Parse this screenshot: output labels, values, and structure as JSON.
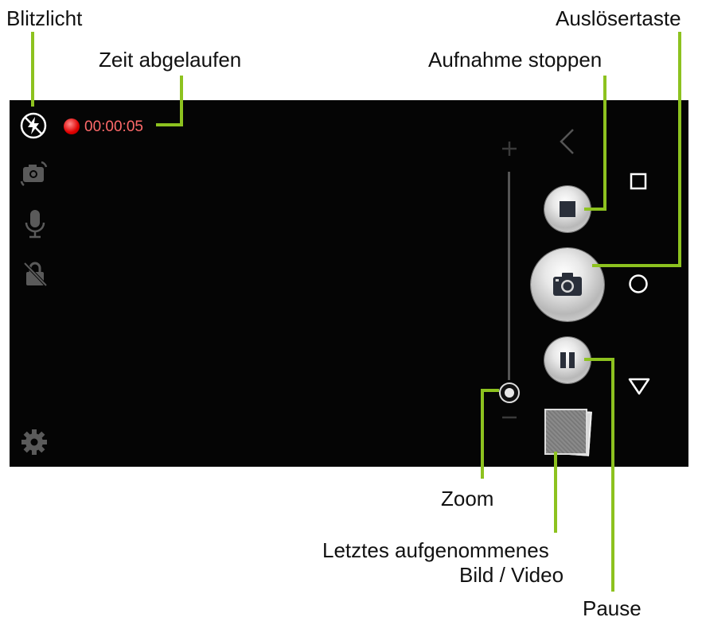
{
  "callouts": {
    "flash": "Blitzlicht",
    "elapsed_time": "Zeit abgelaufen",
    "shutter": "Auslösertaste",
    "stop_recording": "Aufnahme stoppen",
    "zoom": "Zoom",
    "last_media_line1": "Letztes aufgenommenes",
    "last_media_line2": "Bild / Video",
    "pause": "Pause"
  },
  "screen": {
    "recording_time": "00:00:05",
    "zoom_level": 0.0,
    "icons": {
      "flash": "flash-off-icon",
      "switch_camera": "switch-camera-icon",
      "mic": "microphone-icon",
      "lock": "lock-off-icon",
      "settings": "gear-icon",
      "zoom_in": "plus-icon",
      "zoom_out": "minus-icon",
      "stop": "stop-icon",
      "shutter": "camera-icon",
      "pause": "pause-icon",
      "nav_back": "chevron-left-icon",
      "nav_recent": "square-icon",
      "nav_home": "circle-icon",
      "nav_hide": "triangle-down-icon"
    }
  },
  "colors": {
    "callout_line": "#8dc21f",
    "recording_red": "#e00000",
    "time_text": "#ff6a6a"
  }
}
